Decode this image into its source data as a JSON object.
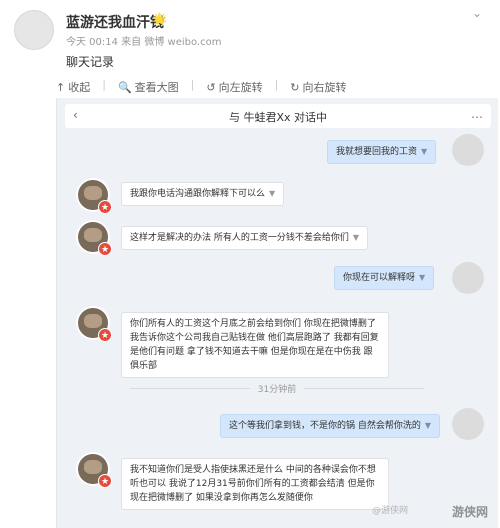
{
  "post": {
    "username": "蓝游还我血汗钱",
    "badge": "🌟",
    "meta": "今天 00:14 来自 微博 weibo.com",
    "text": "聊天记录"
  },
  "tools": {
    "collapse": "收起",
    "view_large": "查看大图",
    "rotate_left": "向左旋转",
    "rotate_right": "向右旋转"
  },
  "chat": {
    "title": "与 牛蛙君Xx 对话中",
    "time_divider": "31分钟前",
    "messages": [
      {
        "side": "right",
        "text": "我就想要回我的工资"
      },
      {
        "side": "left",
        "text": "我跟你电话沟通跟你解释下可以么"
      },
      {
        "side": "left",
        "text": "这样才是解决的办法 所有人的工资一分钱不差会给你们"
      },
      {
        "side": "right",
        "text": "你现在可以解释呀"
      },
      {
        "side": "left",
        "text": "你们所有人的工资这个月底之前会给到你们 你现在把微博删了 我告诉你这个公司我自己贴钱在做 他们高层跑路了 我都有回复 是他们有问题 拿了钱不知道去干嘛 但是你现在是在中伤我 跟俱乐部"
      },
      {
        "side": "right",
        "text": "这个等我们拿到钱，不是你的锅 自然会帮你洗的"
      },
      {
        "side": "left",
        "text": "我不知道你们是受人指使抹黑还是什么 中间的各种误会你不想听也可以 我说了12月31号前你们所有的工资都会结清 但是你现在把微博删了 如果没拿到你再怎么发随便你"
      }
    ]
  },
  "watermark": "游侠网",
  "watermark_small": "@游侠网"
}
